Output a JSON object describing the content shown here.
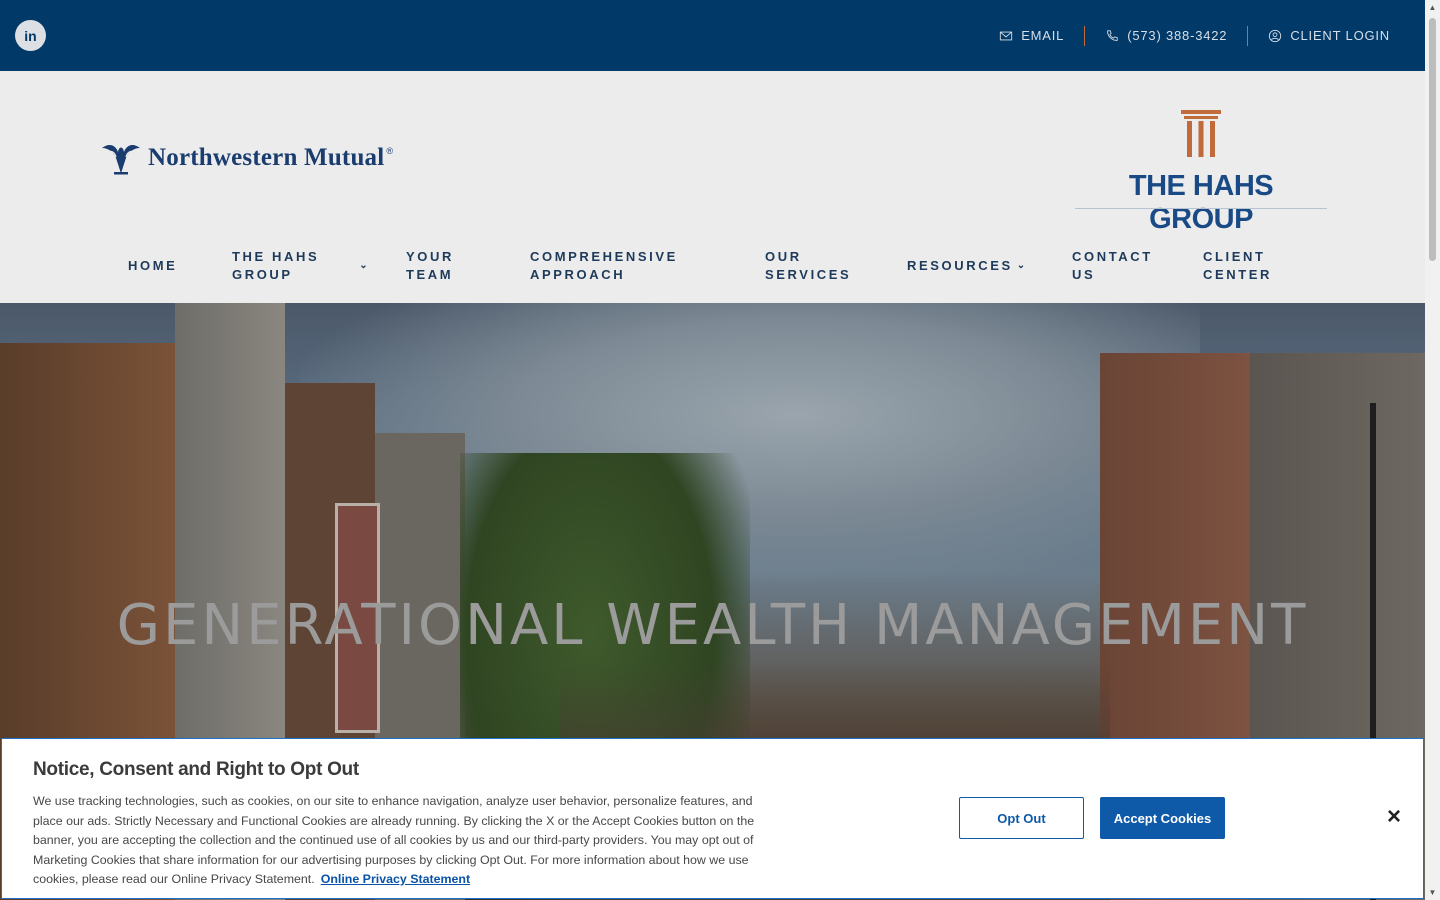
{
  "topbar": {
    "linkedin_label": "in",
    "email_label": "EMAIL",
    "phone_label": "(573) 388-3422",
    "client_login_label": "CLIENT LOGIN"
  },
  "header": {
    "nm_logo_text": "Northwestern Mutual",
    "nm_logo_mark": "®",
    "hahs_logo_text": "THE HAHS GROUP"
  },
  "nav": {
    "home": "HOME",
    "hahs_group_1": "THE HAHS",
    "hahs_group_2": "GROUP",
    "team_1": "YOUR",
    "team_2": "TEAM",
    "approach_1": "COMPREHENSIVE",
    "approach_2": "APPROACH",
    "services_1": "OUR",
    "services_2": "SERVICES",
    "resources": "RESOURCES",
    "contact_1": "CONTACT",
    "contact_2": "US",
    "client_1": "CLIENT",
    "client_2": "CENTER"
  },
  "hero": {
    "title": "GENERATIONAL WEALTH MANAGEMENT"
  },
  "cookie": {
    "title": "Notice, Consent and Right to Opt Out",
    "body": "We use tracking technologies, such as cookies, on our site to enhance navigation, analyze user behavior, personalize features, and place our ads. Strictly Necessary and Functional Cookies are already running. By clicking the X or the Accept Cookies button on the banner, you are accepting the collection and the continued use of all cookies by us and our third-party providers. You may opt out of Marketing Cookies that share information for our advertising purposes by clicking Opt Out. For more information about how we use cookies, please read our Online Privacy Statement.",
    "link": "Online Privacy Statement",
    "opt_out": "Opt Out",
    "accept": "Accept Cookies",
    "close": "×"
  },
  "colors": {
    "topbar": "#013a68",
    "header_bg": "#ececec",
    "accent_orange": "#c16a3b",
    "button_blue": "#0f5aa8"
  }
}
